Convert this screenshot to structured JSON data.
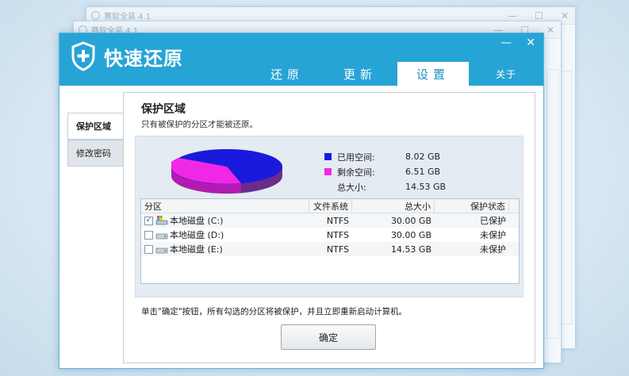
{
  "ghost_windows": [
    {
      "title": "赛软全装 4.1"
    },
    {
      "title": "赛软全装 4.1"
    }
  ],
  "app": {
    "title": "快速还原",
    "window_controls": {
      "minimize": "—",
      "close": "✕"
    }
  },
  "tabs": [
    {
      "label": "还原",
      "active": false
    },
    {
      "label": "更新",
      "active": false
    },
    {
      "label": "设置",
      "active": true
    },
    {
      "label": "关于",
      "active": false
    }
  ],
  "sidebar": {
    "items": [
      {
        "label": "保护区域",
        "active": true
      },
      {
        "label": "修改密码",
        "active": false
      }
    ]
  },
  "panel": {
    "title": "保护区域",
    "subtitle": "只有被保护的分区才能被还原。",
    "usage": {
      "used_label": "已用空间:",
      "used_value": "8.02 GB",
      "free_label": "剩余空间:",
      "free_value": "6.51 GB",
      "total_label": "总大小:",
      "total_value": "14.53 GB",
      "used_color": "#1a1adc",
      "free_color": "#f028e6"
    },
    "table": {
      "headers": [
        "分区",
        "文件系统",
        "总大小",
        "保护状态"
      ],
      "rows": [
        {
          "checked": true,
          "name": "本地磁盘 (C:)",
          "fs": "NTFS",
          "size": "30.00 GB",
          "status": "已保护"
        },
        {
          "checked": false,
          "name": "本地磁盘 (D:)",
          "fs": "NTFS",
          "size": "30.00 GB",
          "status": "未保护"
        },
        {
          "checked": false,
          "name": "本地磁盘 (E:)",
          "fs": "NTFS",
          "size": "14.53 GB",
          "status": "未保护"
        }
      ]
    },
    "note": "单击\"确定\"按钮，所有勾选的分区将被保护，并且立即重新启动计算机。",
    "ok_button": "确定"
  },
  "colors": {
    "header": "#26a4d6",
    "accent": "#1f8fc4"
  }
}
